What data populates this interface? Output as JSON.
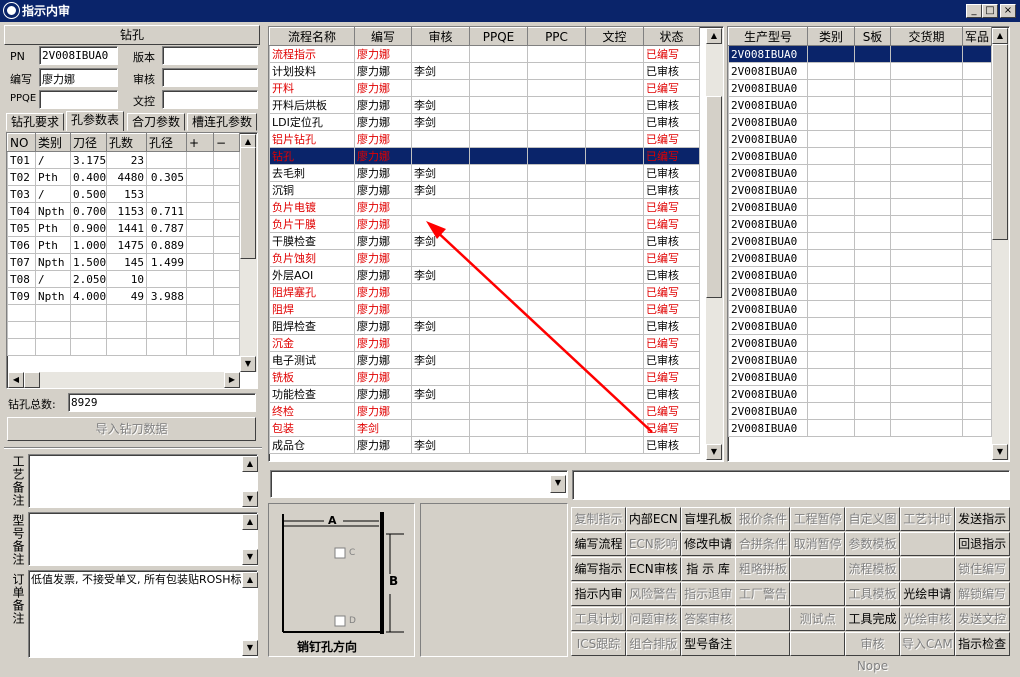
{
  "window": {
    "title": "指示内审",
    "min": "_",
    "max": "□",
    "close": "×"
  },
  "left": {
    "section_title": "钻孔",
    "pn_label": "PN",
    "pn_value": "2V008IBUA0",
    "version_label": "版本",
    "version_value": "",
    "author_label": "编写",
    "author_value": "廖力娜",
    "review_label": "审核",
    "review_value": "",
    "ppqe_label": "PPQE",
    "ppqe_value": "",
    "qc_label": "文控",
    "qc_value": "",
    "tabs": [
      "钻孔要求",
      "孔参数表",
      "合刀参数",
      "槽连孔参数"
    ],
    "table_headers": [
      "NO",
      "类别",
      "刀径",
      "孔数",
      "孔径",
      "+",
      "−"
    ],
    "rows": [
      [
        "T01",
        "/",
        "3.175",
        "23",
        ""
      ],
      [
        "T02",
        "Pth",
        "0.400",
        "4480",
        "0.305"
      ],
      [
        "T03",
        "/",
        "0.500",
        "153",
        ""
      ],
      [
        "T04",
        "Npth",
        "0.700",
        "1153",
        "0.711"
      ],
      [
        "T05",
        "Pth",
        "0.900",
        "1441",
        "0.787"
      ],
      [
        "T06",
        "Pth",
        "1.000",
        "1475",
        "0.889"
      ],
      [
        "T07",
        "Npth",
        "1.500",
        "145",
        "1.499"
      ],
      [
        "T08",
        "/",
        "2.050",
        "10",
        ""
      ],
      [
        "T09",
        "Npth",
        "4.000",
        "49",
        "3.988"
      ]
    ],
    "total_label": "钻孔总数:",
    "total_value": "8929",
    "import_btn": "导入钻刀数据",
    "process_note_label": "工艺备注",
    "process_note": "",
    "model_note_label": "型号备注",
    "model_note": "",
    "order_note_label": "订单备注",
    "order_note": "低值发票, 不接受单叉, 所有包装贴ROSH标签"
  },
  "flow": {
    "headers": [
      "流程名称",
      "编写",
      "审核",
      "PPQE",
      "PPC",
      "文控",
      "状态"
    ],
    "rows": [
      {
        "name": "流程指示",
        "author": "廖力娜",
        "reviewer": "",
        "status": "已编写",
        "red": true
      },
      {
        "name": "计划投料",
        "author": "廖力娜",
        "reviewer": "李剑",
        "status": "已审核",
        "red": false
      },
      {
        "name": "开料",
        "author": "廖力娜",
        "reviewer": "",
        "status": "已编写",
        "red": true
      },
      {
        "name": "开料后烘板",
        "author": "廖力娜",
        "reviewer": "李剑",
        "status": "已审核",
        "red": false
      },
      {
        "name": "LDI定位孔",
        "author": "廖力娜",
        "reviewer": "李剑",
        "status": "已审核",
        "red": false
      },
      {
        "name": "铝片钻孔",
        "author": "廖力娜",
        "reviewer": "",
        "status": "已编写",
        "red": true
      },
      {
        "name": "钻孔",
        "author": "廖力娜",
        "reviewer": "",
        "status": "已编写",
        "red": true,
        "selected": true
      },
      {
        "name": "去毛刺",
        "author": "廖力娜",
        "reviewer": "李剑",
        "status": "已审核",
        "red": false
      },
      {
        "name": "沉铜",
        "author": "廖力娜",
        "reviewer": "李剑",
        "status": "已审核",
        "red": false
      },
      {
        "name": "负片电镀",
        "author": "廖力娜",
        "reviewer": "",
        "status": "已编写",
        "red": true
      },
      {
        "name": "负片干膜",
        "author": "廖力娜",
        "reviewer": "",
        "status": "已编写",
        "red": true
      },
      {
        "name": "干膜检查",
        "author": "廖力娜",
        "reviewer": "李剑",
        "status": "已审核",
        "red": false
      },
      {
        "name": "负片蚀刻",
        "author": "廖力娜",
        "reviewer": "",
        "status": "已编写",
        "red": true
      },
      {
        "name": "外层AOI",
        "author": "廖力娜",
        "reviewer": "李剑",
        "status": "已审核",
        "red": false
      },
      {
        "name": "阻焊塞孔",
        "author": "廖力娜",
        "reviewer": "",
        "status": "已编写",
        "red": true
      },
      {
        "name": "阻焊",
        "author": "廖力娜",
        "reviewer": "",
        "status": "已编写",
        "red": true
      },
      {
        "name": "阻焊检查",
        "author": "廖力娜",
        "reviewer": "李剑",
        "status": "已审核",
        "red": false
      },
      {
        "name": "沉金",
        "author": "廖力娜",
        "reviewer": "",
        "status": "已编写",
        "red": true
      },
      {
        "name": "电子测试",
        "author": "廖力娜",
        "reviewer": "李剑",
        "status": "已审核",
        "red": false
      },
      {
        "name": "铣板",
        "author": "廖力娜",
        "reviewer": "",
        "status": "已编写",
        "red": true
      },
      {
        "name": "功能检查",
        "author": "廖力娜",
        "reviewer": "李剑",
        "status": "已审核",
        "red": false
      },
      {
        "name": "终检",
        "author": "廖力娜",
        "reviewer": "",
        "status": "已编写",
        "red": true
      },
      {
        "name": "包装",
        "author": "李剑",
        "reviewer": "",
        "status": "已编写",
        "red": true
      },
      {
        "name": "成品仓",
        "author": "廖力娜",
        "reviewer": "李剑",
        "status": "已审核",
        "red": false
      }
    ]
  },
  "models": {
    "headers": [
      "生产型号",
      "类别",
      "S板",
      "交货期",
      "军品"
    ],
    "rows": [
      "2V008IBUA0",
      "2V008IBUA0",
      "2V008IBUA0",
      "2V008IBUA0",
      "2V008IBUA0",
      "2V008IBUA0",
      "2V008IBUA0",
      "2V008IBUA0",
      "2V008IBUA0",
      "2V008IBUA0",
      "2V008IBUA0",
      "2V008IBUA0",
      "2V008IBUA0",
      "2V008IBUA0",
      "2V008IBUA0",
      "2V008IBUA0",
      "2V008IBUA0",
      "2V008IBUA0",
      "2V008IBUA0",
      "2V008IBUA0",
      "2V008IBUA0",
      "2V008IBUA0",
      "2V008IBUA0"
    ]
  },
  "diagram": {
    "a": "A",
    "b": "B",
    "c": "C",
    "d": "D",
    "caption": "销钉孔方向"
  },
  "actions": [
    [
      "复制指示",
      "内部ECN",
      "盲埋孔板",
      "报价条件",
      "工程暂停",
      "自定义图",
      "工艺计时",
      "发送指示"
    ],
    [
      "编写流程",
      "ECN影响",
      "修改申请",
      "合拼条件",
      "取消暂停",
      "参数模板",
      "",
      "回退指示"
    ],
    [
      "编写指示",
      "ECN审核",
      "指 示 库",
      "粗略拼板",
      "",
      "流程模板",
      "",
      "锁住编写"
    ],
    [
      "指示内审",
      "风险警告",
      "指示退审",
      "工厂警告",
      "",
      "工具模板",
      "光绘申请",
      "解锁编写"
    ],
    [
      "工具计划",
      "问题审核",
      "答案审核",
      "",
      "测试点",
      "工具完成",
      "光绘审核",
      "发送文控"
    ],
    [
      "ICS跟踪",
      "组合排版",
      "型号备注",
      "",
      "",
      "审核Nope",
      "导入CAM",
      "指示检查"
    ]
  ],
  "action_enabled": [
    [
      false,
      true,
      true,
      false,
      false,
      false,
      false,
      true
    ],
    [
      true,
      false,
      true,
      false,
      false,
      false,
      false,
      true
    ],
    [
      true,
      true,
      true,
      false,
      false,
      false,
      false,
      false
    ],
    [
      true,
      false,
      false,
      false,
      false,
      false,
      true,
      false
    ],
    [
      false,
      false,
      false,
      false,
      false,
      true,
      false,
      false
    ],
    [
      false,
      false,
      true,
      false,
      false,
      false,
      false,
      true
    ]
  ]
}
